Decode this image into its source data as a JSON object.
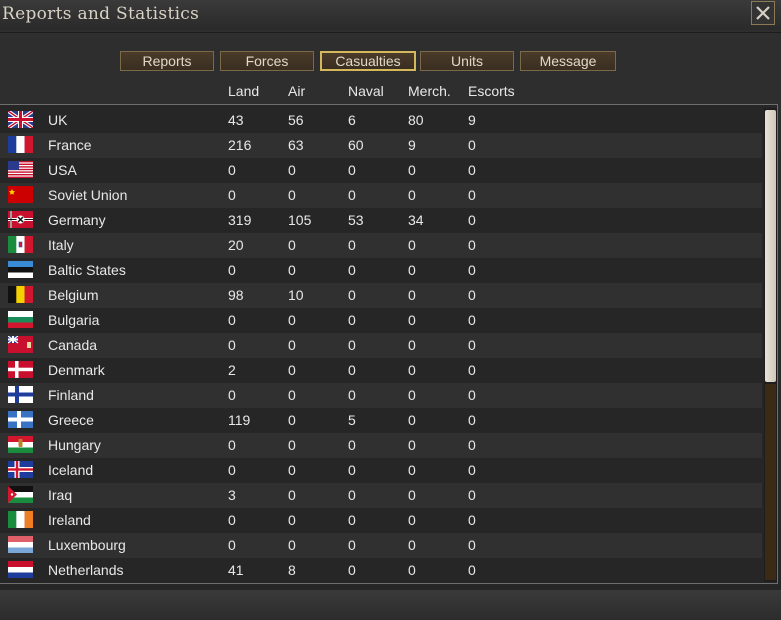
{
  "window": {
    "title": "Reports and Statistics"
  },
  "tabs": [
    {
      "label": "Reports",
      "active": false
    },
    {
      "label": "Forces",
      "active": false
    },
    {
      "label": "Casualties",
      "active": true
    },
    {
      "label": "Units",
      "active": false
    },
    {
      "label": "Message",
      "active": false
    }
  ],
  "columns": {
    "land": "Land",
    "air": "Air",
    "naval": "Naval",
    "merch": "Merch.",
    "escorts": "Escorts"
  },
  "rows": [
    {
      "country": "UK",
      "flag": "uk-flag-icon",
      "land": "43",
      "air": "56",
      "naval": "6",
      "merch": "80",
      "escorts": "9"
    },
    {
      "country": "France",
      "flag": "france-flag-icon",
      "land": "216",
      "air": "63",
      "naval": "60",
      "merch": "9",
      "escorts": "0"
    },
    {
      "country": "USA",
      "flag": "usa-flag-icon",
      "land": "0",
      "air": "0",
      "naval": "0",
      "merch": "0",
      "escorts": "0"
    },
    {
      "country": "Soviet Union",
      "flag": "soviet-flag-icon",
      "land": "0",
      "air": "0",
      "naval": "0",
      "merch": "0",
      "escorts": "0"
    },
    {
      "country": "Germany",
      "flag": "germany-flag-icon",
      "land": "319",
      "air": "105",
      "naval": "53",
      "merch": "34",
      "escorts": "0"
    },
    {
      "country": "Italy",
      "flag": "italy-flag-icon",
      "land": "20",
      "air": "0",
      "naval": "0",
      "merch": "0",
      "escorts": "0"
    },
    {
      "country": "Baltic States",
      "flag": "baltic-flag-icon",
      "land": "0",
      "air": "0",
      "naval": "0",
      "merch": "0",
      "escorts": "0"
    },
    {
      "country": "Belgium",
      "flag": "belgium-flag-icon",
      "land": "98",
      "air": "10",
      "naval": "0",
      "merch": "0",
      "escorts": "0"
    },
    {
      "country": "Bulgaria",
      "flag": "bulgaria-flag-icon",
      "land": "0",
      "air": "0",
      "naval": "0",
      "merch": "0",
      "escorts": "0"
    },
    {
      "country": "Canada",
      "flag": "canada-flag-icon",
      "land": "0",
      "air": "0",
      "naval": "0",
      "merch": "0",
      "escorts": "0"
    },
    {
      "country": "Denmark",
      "flag": "denmark-flag-icon",
      "land": "2",
      "air": "0",
      "naval": "0",
      "merch": "0",
      "escorts": "0"
    },
    {
      "country": "Finland",
      "flag": "finland-flag-icon",
      "land": "0",
      "air": "0",
      "naval": "0",
      "merch": "0",
      "escorts": "0"
    },
    {
      "country": "Greece",
      "flag": "greece-flag-icon",
      "land": "119",
      "air": "0",
      "naval": "5",
      "merch": "0",
      "escorts": "0"
    },
    {
      "country": "Hungary",
      "flag": "hungary-flag-icon",
      "land": "0",
      "air": "0",
      "naval": "0",
      "merch": "0",
      "escorts": "0"
    },
    {
      "country": "Iceland",
      "flag": "iceland-flag-icon",
      "land": "0",
      "air": "0",
      "naval": "0",
      "merch": "0",
      "escorts": "0"
    },
    {
      "country": "Iraq",
      "flag": "iraq-flag-icon",
      "land": "3",
      "air": "0",
      "naval": "0",
      "merch": "0",
      "escorts": "0"
    },
    {
      "country": "Ireland",
      "flag": "ireland-flag-icon",
      "land": "0",
      "air": "0",
      "naval": "0",
      "merch": "0",
      "escorts": "0"
    },
    {
      "country": "Luxembourg",
      "flag": "luxembourg-flag-icon",
      "land": "0",
      "air": "0",
      "naval": "0",
      "merch": "0",
      "escorts": "0"
    },
    {
      "country": "Netherlands",
      "flag": "netherlands-flag-icon",
      "land": "41",
      "air": "8",
      "naval": "0",
      "merch": "0",
      "escorts": "0"
    }
  ]
}
